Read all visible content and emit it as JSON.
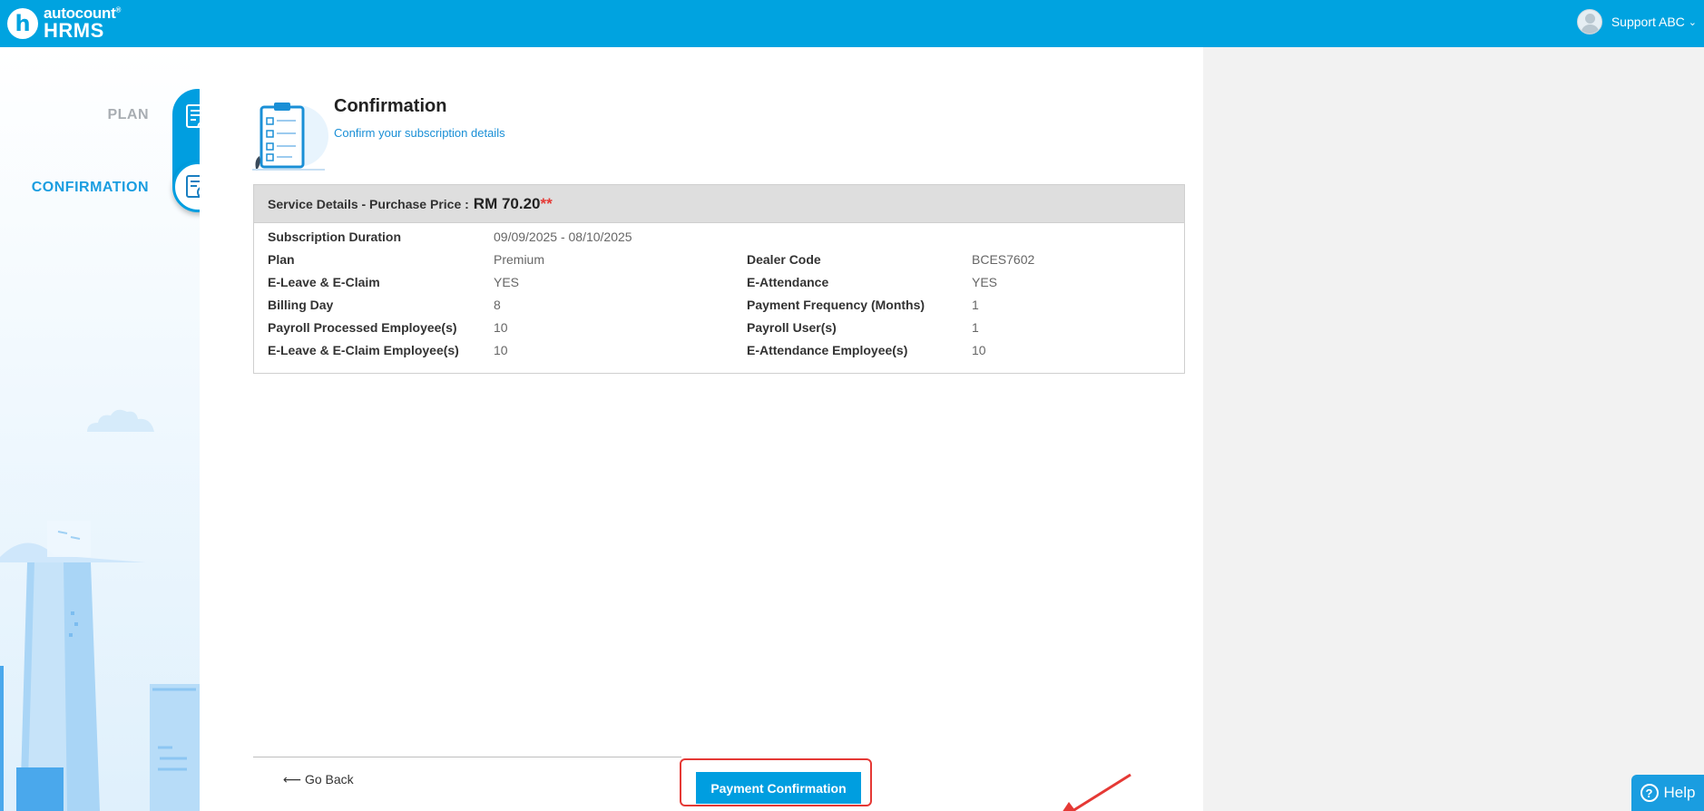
{
  "header": {
    "logo_mark": "h",
    "logo_top": "autocount",
    "logo_reg": "®",
    "logo_bottom": "HRMS",
    "user_name": "Support ABC",
    "accent_color": "#00a3e0"
  },
  "steps": [
    {
      "label": "PLAN",
      "icon": "plan-edit-icon",
      "state": "done"
    },
    {
      "label": "CONFIRMATION",
      "icon": "confirmation-check-icon",
      "state": "active"
    }
  ],
  "page": {
    "title": "Confirmation",
    "subtitle": "Confirm your subscription details"
  },
  "service": {
    "heading": "Service Details - Purchase Price :",
    "price": "RM 70.20",
    "price_marker": "**",
    "rows": [
      {
        "label1": "Subscription Duration",
        "value1": "09/09/2025 - 08/10/2025",
        "label2": "",
        "value2": ""
      },
      {
        "label1": "Plan",
        "value1": "Premium",
        "label2": "Dealer Code",
        "value2": "BCES7602"
      },
      {
        "label1": "E-Leave & E-Claim",
        "value1": "YES",
        "label2": "E-Attendance",
        "value2": "YES"
      },
      {
        "label1": "Billing Day",
        "value1": "8",
        "label2": "Payment Frequency (Months)",
        "value2": "1"
      },
      {
        "label1": "Payroll Processed Employee(s)",
        "value1": "10",
        "label2": "Payroll User(s)",
        "value2": "1"
      },
      {
        "label1": "E-Leave & E-Claim Employee(s)",
        "value1": "10",
        "label2": "E-Attendance Employee(s)",
        "value2": "10"
      }
    ]
  },
  "footer": {
    "go_back": "⟵ Go Back",
    "payment_button": "Payment Confirmation",
    "help": "Help"
  }
}
